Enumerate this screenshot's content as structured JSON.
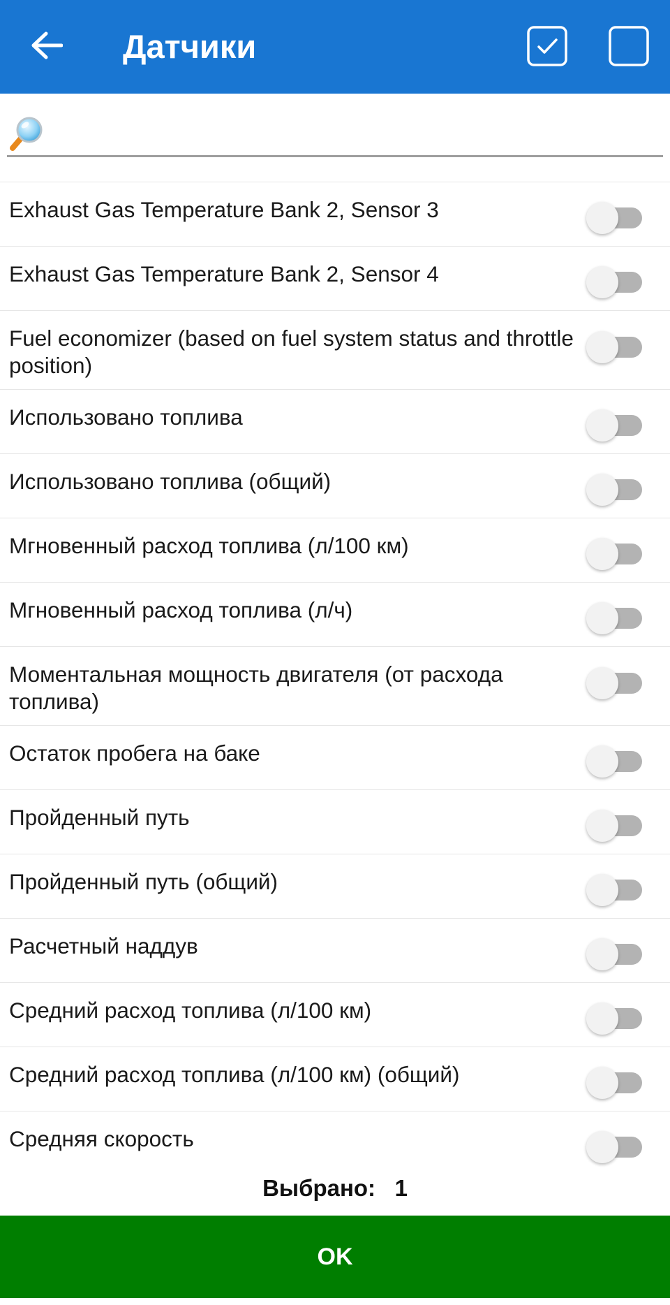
{
  "header": {
    "title": "Датчики",
    "back_icon": "arrow-left-icon",
    "select_all_icon": "checkbox-checked-icon",
    "deselect_all_icon": "checkbox-empty-icon",
    "bar_color": "#1976d2"
  },
  "search": {
    "icon": "magnifier-icon",
    "value": "",
    "placeholder": ""
  },
  "sensors": [
    {
      "label": "Exhaust Gas Temperature Bank 2, Sensor 3",
      "enabled": false
    },
    {
      "label": "Exhaust Gas Temperature Bank 2, Sensor 4",
      "enabled": false
    },
    {
      "label": "Fuel economizer (based on fuel system status and throttle position)",
      "enabled": false
    },
    {
      "label": "Использовано топлива",
      "enabled": false
    },
    {
      "label": "Использовано топлива (общий)",
      "enabled": false
    },
    {
      "label": "Мгновенный расход топлива (л/100 км)",
      "enabled": false
    },
    {
      "label": "Мгновенный расход топлива (л/ч)",
      "enabled": false
    },
    {
      "label": "Моментальная мощность двигателя (от расхода топлива)",
      "enabled": false
    },
    {
      "label": "Остаток пробега на баке",
      "enabled": false
    },
    {
      "label": "Пройденный путь",
      "enabled": false
    },
    {
      "label": "Пройденный путь (общий)",
      "enabled": false
    },
    {
      "label": "Расчетный наддув",
      "enabled": false
    },
    {
      "label": "Средний расход топлива (л/100 км)",
      "enabled": false
    },
    {
      "label": "Средний расход топлива (л/100 км) (общий)",
      "enabled": false
    },
    {
      "label": "Средняя скорость",
      "enabled": false
    }
  ],
  "footer": {
    "selected_label": "Выбрано:",
    "selected_count": "1",
    "ok_label": "OK",
    "ok_color": "#007e00"
  }
}
